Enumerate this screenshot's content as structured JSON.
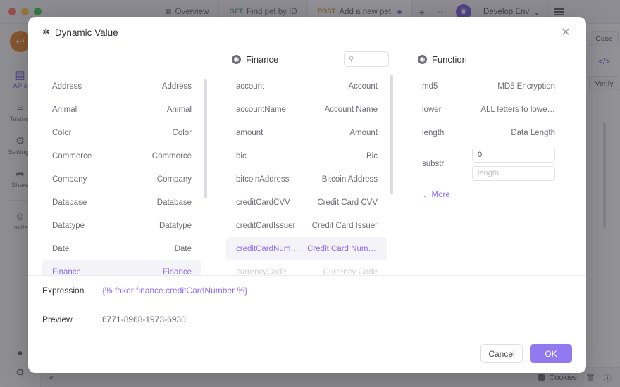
{
  "background": {
    "tabs": [
      {
        "method": "",
        "label": "Overview",
        "icon": "grid-icon"
      },
      {
        "method": "GET",
        "label": "Find pet by ID",
        "icon": ""
      },
      {
        "method": "POST",
        "label": "Add a new pet",
        "icon": ""
      }
    ],
    "toolbar": {
      "add_label": "+",
      "more_label": "⋯",
      "avatar_label": "ⓘ",
      "env_label": "Develop Env",
      "env_caret": "⌄"
    },
    "rail": {
      "logo_glyph": "↩",
      "items": [
        {
          "label": "APIs",
          "glyph": "▤"
        },
        {
          "label": "Testing",
          "glyph": "≡"
        },
        {
          "label": "Settings",
          "glyph": "⚙"
        },
        {
          "label": "Share",
          "glyph": "➦"
        },
        {
          "label": "Invite",
          "glyph": "☺"
        }
      ],
      "bottom": [
        {
          "name": "notifications",
          "glyph": "●"
        },
        {
          "name": "settings",
          "glyph": "⚙"
        }
      ]
    },
    "right_rail": {
      "case_label": "Case",
      "code_glyph": "</>",
      "verify_label": "Verify"
    },
    "statusbar": {
      "collapse_glyph": "«",
      "cookies_label": "Cookies",
      "trash_glyph": "Ὕ1",
      "help_glyph": "?"
    }
  },
  "modal": {
    "title": "Dynamic Value",
    "title_icon": "magic-wand-icon",
    "close_label": "✕",
    "category_column": {
      "items": [
        {
          "key": "Address",
          "value": "Address",
          "selected": false
        },
        {
          "key": "Animal",
          "value": "Animal",
          "selected": false
        },
        {
          "key": "Color",
          "value": "Color",
          "selected": false
        },
        {
          "key": "Commerce",
          "value": "Commerce",
          "selected": false
        },
        {
          "key": "Company",
          "value": "Company",
          "selected": false
        },
        {
          "key": "Database",
          "value": "Database",
          "selected": false
        },
        {
          "key": "Datatype",
          "value": "Datatype",
          "selected": false
        },
        {
          "key": "Date",
          "value": "Date",
          "selected": false
        },
        {
          "key": "Finance",
          "value": "Finance",
          "selected": true
        }
      ]
    },
    "field_column": {
      "header": "Finance",
      "header_icon": "category-icon",
      "search_placeholder": "",
      "search_value": "",
      "search_icon": "search-icon",
      "items": [
        {
          "key": "account",
          "value": "Account",
          "selected": false
        },
        {
          "key": "accountName",
          "value": "Account Name",
          "selected": false
        },
        {
          "key": "amount",
          "value": "Amount",
          "selected": false
        },
        {
          "key": "bic",
          "value": "Bic",
          "selected": false
        },
        {
          "key": "bitcoinAddress",
          "value": "Bitcoin Address",
          "selected": false
        },
        {
          "key": "creditCardCVV",
          "value": "Credit Card CVV",
          "selected": false
        },
        {
          "key": "creditCardIssuer",
          "value": "Credit Card Issuer",
          "selected": false
        },
        {
          "key": "creditCardNumber",
          "value": "Credit Card Number",
          "selected": true
        },
        {
          "key": "currencyCode",
          "value": "Currency Code",
          "selected": false
        }
      ]
    },
    "function_column": {
      "header": "Function",
      "header_icon": "function-icon",
      "items": [
        {
          "key": "md5",
          "value": "MD5 Encryption"
        },
        {
          "key": "lower",
          "value": "ALL letters to lowe…"
        },
        {
          "key": "length",
          "value": "Data Length"
        }
      ],
      "substr": {
        "label": "substr",
        "start_value": "0",
        "length_value": "",
        "length_placeholder": "length"
      },
      "more_label": "More",
      "more_chevron": "⌄"
    },
    "expression": {
      "label": "Expression",
      "value": "{% faker finance.creditCardNumber %}"
    },
    "preview": {
      "label": "Preview",
      "value": "6771-8968-1973-6930"
    },
    "footer": {
      "cancel_label": "Cancel",
      "ok_label": "OK"
    }
  },
  "colors": {
    "accent": "#8a6df0",
    "primary_button": "#9379ef",
    "selected_row_bg": "#f4f3f7"
  }
}
